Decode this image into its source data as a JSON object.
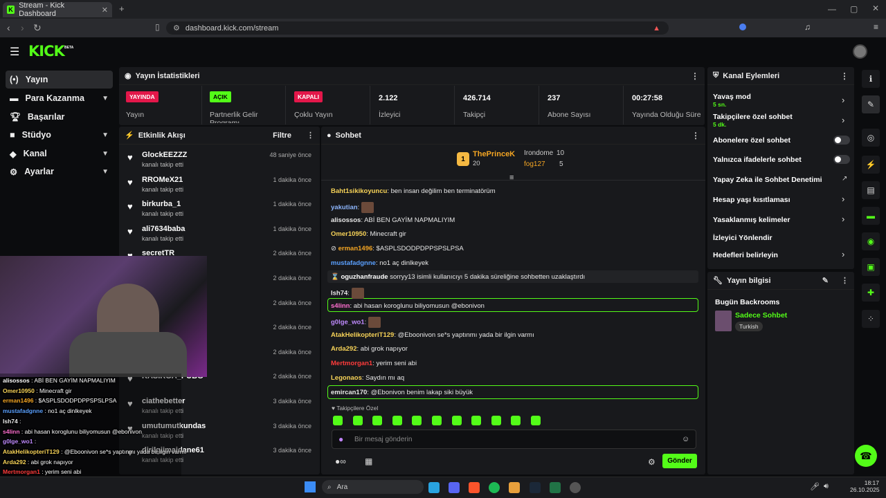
{
  "browser": {
    "tab_title": "Stream - Kick Dashboard",
    "url": "dashboard.kick.com/stream",
    "new_tab": "+"
  },
  "brand": {
    "logo": "KICK",
    "beta": "BETA",
    "accent": "#53fc18"
  },
  "sidebar": {
    "items": [
      {
        "label": "Yayın"
      },
      {
        "label": "Para Kazanma"
      },
      {
        "label": "Başarılar"
      },
      {
        "label": "Stüdyo"
      },
      {
        "label": "Kanal"
      },
      {
        "label": "Ayarlar"
      }
    ]
  },
  "stats": {
    "title": "Yayın İstatistikleri",
    "cells": [
      {
        "badge": "YAYINDA",
        "label": "Yayın"
      },
      {
        "badge": "AÇIK",
        "label": "Partnerlik Gelir Programı"
      },
      {
        "badge": "KAPALI",
        "label": "Çoklu Yayın"
      },
      {
        "value": "2.122",
        "label": "İzleyici"
      },
      {
        "value": "426.714",
        "label": "Takipçi"
      },
      {
        "value": "237",
        "label": "Abone Sayısı"
      },
      {
        "value": "00:27:58",
        "label": "Yayında Olduğu Süre"
      }
    ]
  },
  "activity": {
    "title": "Etkinlik Akışı",
    "filter": "Filtre",
    "items": [
      {
        "name": "GlockEEZZZ",
        "sub": "kanalı takip etti",
        "time": "48 saniye önce"
      },
      {
        "name": "RROMeX21",
        "sub": "kanalı takip etti",
        "time": "1 dakika önce"
      },
      {
        "name": "birkurba_1",
        "sub": "kanalı takip etti",
        "time": "1 dakika önce"
      },
      {
        "name": "ali7634baba",
        "sub": "kanalı takip etti",
        "time": "1 dakika önce"
      },
      {
        "name": "secretTR",
        "sub": "",
        "time": "2 dakika önce"
      },
      {
        "name": "",
        "sub": "",
        "time": "2 dakika önce"
      },
      {
        "name": "",
        "sub": "",
        "time": "2 dakika önce"
      },
      {
        "name": "",
        "sub": "",
        "time": "2 dakika önce"
      },
      {
        "name": "",
        "sub": "",
        "time": "2 dakika önce"
      },
      {
        "name": "KASIRGA_PUBG",
        "sub": "",
        "time": "2 dakika önce"
      },
      {
        "name": "ciathebetter",
        "sub": "kanalı takip etti",
        "time": "3 dakika önce"
      },
      {
        "name": "umutumutkundas",
        "sub": "kanalı takip etti",
        "time": "3 dakika önce"
      },
      {
        "name": "dirilgiimaidane61",
        "sub": "kanalı takip etti",
        "time": "3 dakika önce"
      }
    ]
  },
  "chat": {
    "title": "Sohbet",
    "top": {
      "rank": "1",
      "user1": "ThePrinceK",
      "user1_count": "20",
      "user2": "Irondome",
      "user2_count": "10",
      "user3": "fog127",
      "user3_count": "5"
    },
    "messages": [
      {
        "user": "Baht1sikikoyuncu",
        "text": "ben insan değilim ben terminatörüm",
        "color": "#f7d358"
      },
      {
        "user": "yakutian",
        "text": "",
        "color": "#8fb8ff"
      },
      {
        "user": "alisossos",
        "text": "ABİ BEN GAYİM NAPMALIYIM",
        "color": "#e8e8e8"
      },
      {
        "user": "Omer10950",
        "text": "Minecraft gir",
        "color": "#f7d358"
      },
      {
        "user": "erman1496",
        "text": "$ASPLSDODPDPPSPSLPSA",
        "color": "#f5a623"
      },
      {
        "user": "mustafadgnne",
        "text": "no1 aç dinlkeyek",
        "color": "#5aa0ff"
      },
      {
        "user": "oguzhanfraude",
        "text": "sorryy13 isimli kullanıcıyı 5 dakika süreliğine sohbetten uzaklaştırdı",
        "color": "#fff"
      },
      {
        "user": "Ish74",
        "text": "",
        "color": "#e8e8e8"
      },
      {
        "user": "s4linn",
        "text": "abi hasan koroglunu biliyomusun @ebonivon",
        "color": "#ff6fd0"
      },
      {
        "user": "g0lge_wo1",
        "text": "",
        "color": "#c08bff"
      },
      {
        "user": "AtakHelikopteriT129",
        "text": "@Eboonivon se*s yaptınmı yada bir ilgin varmı",
        "color": "#f7d358"
      },
      {
        "user": "Arda292",
        "text": "abi grok napıyor",
        "color": "#f7d358"
      },
      {
        "user": "Mertmorgan1",
        "text": "yerim seni abi",
        "color": "#ff3b3b"
      },
      {
        "user": "Legonaos",
        "text": "Saydın mı aq",
        "color": "#f7d358"
      },
      {
        "user": "emircan170",
        "text": "@Ebonivon benim lakap siki büyük",
        "color": "#e8e8e8"
      }
    ],
    "followers_only": "Takipçilere Özel",
    "input_placeholder": "Bir mesaj gönderin",
    "send": "Gönder"
  },
  "channel_actions": {
    "title": "Kanal Eylemleri",
    "items": [
      {
        "label": "Yavaş mod",
        "sub": "5 sn."
      },
      {
        "label": "Takipçilere özel sohbet",
        "sub": "5 dk."
      },
      {
        "label": "Abonelere özel sohbet",
        "sub": ""
      },
      {
        "label": "Yalnızca ifadelerle sohbet",
        "sub": ""
      },
      {
        "label": "Yapay Zeka ile Sohbet Denetimi",
        "sub": ""
      },
      {
        "label": "Hesap yaşı kısıtlaması",
        "sub": ""
      },
      {
        "label": "Yasaklanmış kelimeler",
        "sub": ""
      },
      {
        "label": "İzleyici Yönlendir",
        "sub": ""
      },
      {
        "label": "Hedefleri belirleyin",
        "sub": ""
      }
    ]
  },
  "stream_info": {
    "title": "Yayın bilgisi",
    "stream_title": "Bugün Backrooms",
    "category": "Sadece Sohbet",
    "tag": "Turkish"
  },
  "overlay_chat": [
    {
      "user": "alisossos",
      "text": "ABİ BEN GAYİM NAPMALIYIM"
    },
    {
      "user": "Omer10950",
      "text": "Minecraft gir"
    },
    {
      "user": "erman1496",
      "text": "$ASPLSDODPDPPSPSLPSA"
    },
    {
      "user": "mustafadgnne",
      "text": "no1 aç dinlkeyek"
    },
    {
      "user": "Ish74",
      "text": ""
    },
    {
      "user": "s4linn",
      "text": "abi hasan koroglunu biliyomusun @ebonivon"
    },
    {
      "user": "g0lge_wo1",
      "text": ""
    },
    {
      "user": "AtakHelikopteriT129",
      "text": "@Eboonivon se*s yaptınmı yada bir ilgin varmı"
    },
    {
      "user": "Arda292",
      "text": "abi grok napıyor"
    },
    {
      "user": "Mertmorgan1",
      "text": "yerim seni abi"
    },
    {
      "user": "Legonaos",
      "text": "Saydın mı aq"
    },
    {
      "user": "emircan170",
      "text": "@Ebonivon benim lakap siki büyük"
    }
  ],
  "taskbar": {
    "search": "Ara",
    "time": "18:17",
    "date": "26.10.2025"
  }
}
